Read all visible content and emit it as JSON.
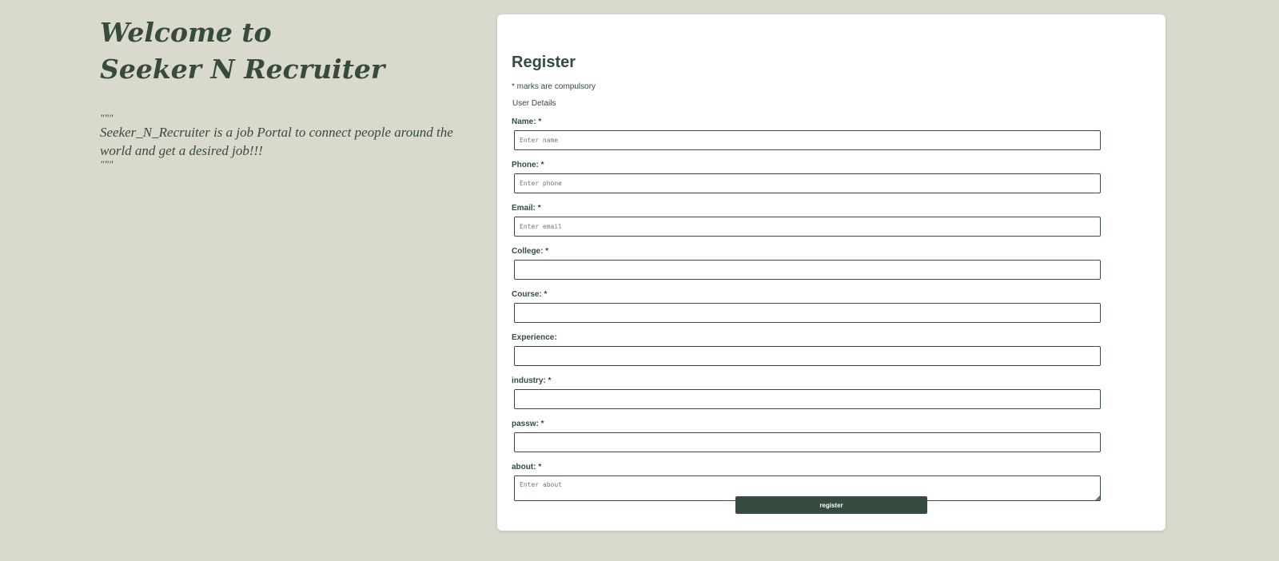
{
  "hero": {
    "welcome_line1": "Welcome to",
    "welcome_line2": "Seeker N Recruiter",
    "quote_open": "\"\"\"",
    "description": "Seeker_N_Recruiter is a job Portal to connect people around the world and get a desired job!!!",
    "quote_close": "\"\"\""
  },
  "form": {
    "title": "Register",
    "note": "* marks are compulsory",
    "section": "User Details",
    "fields": [
      {
        "label": "Name: *",
        "placeholder": "Enter name",
        "value": ""
      },
      {
        "label": "Phone: *",
        "placeholder": "Enter phone",
        "value": ""
      },
      {
        "label": "Email: *",
        "placeholder": "Enter email",
        "value": ""
      },
      {
        "label": "College: *",
        "placeholder": "",
        "value": ""
      },
      {
        "label": "Course: *",
        "placeholder": "",
        "value": ""
      },
      {
        "label": "Experience:",
        "placeholder": "",
        "value": ""
      },
      {
        "label": "industry: *",
        "placeholder": "",
        "value": ""
      },
      {
        "label": "passw: *",
        "placeholder": "",
        "value": ""
      },
      {
        "label": "about: *",
        "placeholder": "Enter about",
        "value": ""
      }
    ],
    "submit_label": "register"
  },
  "colors": {
    "background": "#dad9cd",
    "accent": "#344b3d",
    "card": "#ffffff"
  }
}
